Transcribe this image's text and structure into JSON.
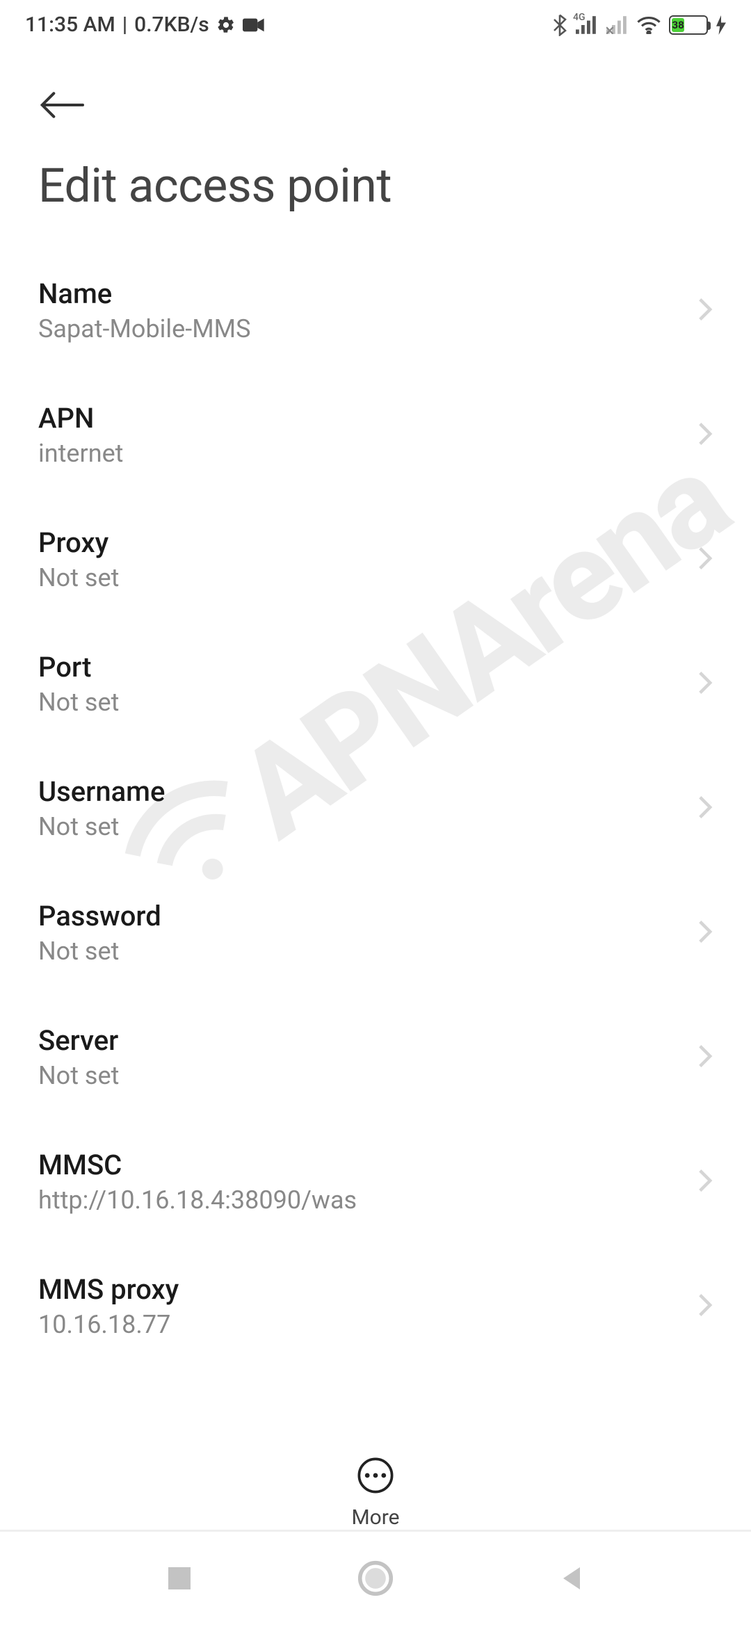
{
  "status_bar": {
    "time": "11:35 AM",
    "data_rate": "0.7KB/s",
    "network_label": "4G",
    "battery_percent": "38"
  },
  "page": {
    "title": "Edit access point"
  },
  "settings": [
    {
      "label": "Name",
      "value": "Sapat-Mobile-MMS"
    },
    {
      "label": "APN",
      "value": "internet"
    },
    {
      "label": "Proxy",
      "value": "Not set"
    },
    {
      "label": "Port",
      "value": "Not set"
    },
    {
      "label": "Username",
      "value": "Not set"
    },
    {
      "label": "Password",
      "value": "Not set"
    },
    {
      "label": "Server",
      "value": "Not set"
    },
    {
      "label": "MMSC",
      "value": "http://10.16.18.4:38090/was"
    },
    {
      "label": "MMS proxy",
      "value": "10.16.18.77"
    }
  ],
  "bottom_bar": {
    "more_label": "More"
  },
  "watermark": {
    "text": "APNArena"
  }
}
